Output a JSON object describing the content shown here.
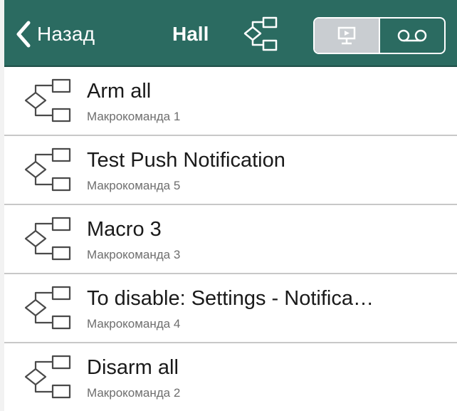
{
  "header": {
    "back_label": "Назад",
    "title": "Hall",
    "title_icon": "macro-flow-icon",
    "segments": [
      {
        "icon": "monitor-icon",
        "selected": true
      },
      {
        "icon": "voicemail-icon",
        "selected": false
      }
    ],
    "bar_color": "#2b6b61"
  },
  "macros": [
    {
      "name": "Arm all",
      "subtitle": "Макрокоманда 1"
    },
    {
      "name": "Test Push Notification",
      "subtitle": "Макрокоманда 5"
    },
    {
      "name": "Macro 3",
      "subtitle": "Макрокоманда 3"
    },
    {
      "name": "To disable: Settings - Notifica…",
      "subtitle": "Макрокоманда 4"
    },
    {
      "name": "Disarm all",
      "subtitle": "Макрокоманда 2"
    }
  ]
}
